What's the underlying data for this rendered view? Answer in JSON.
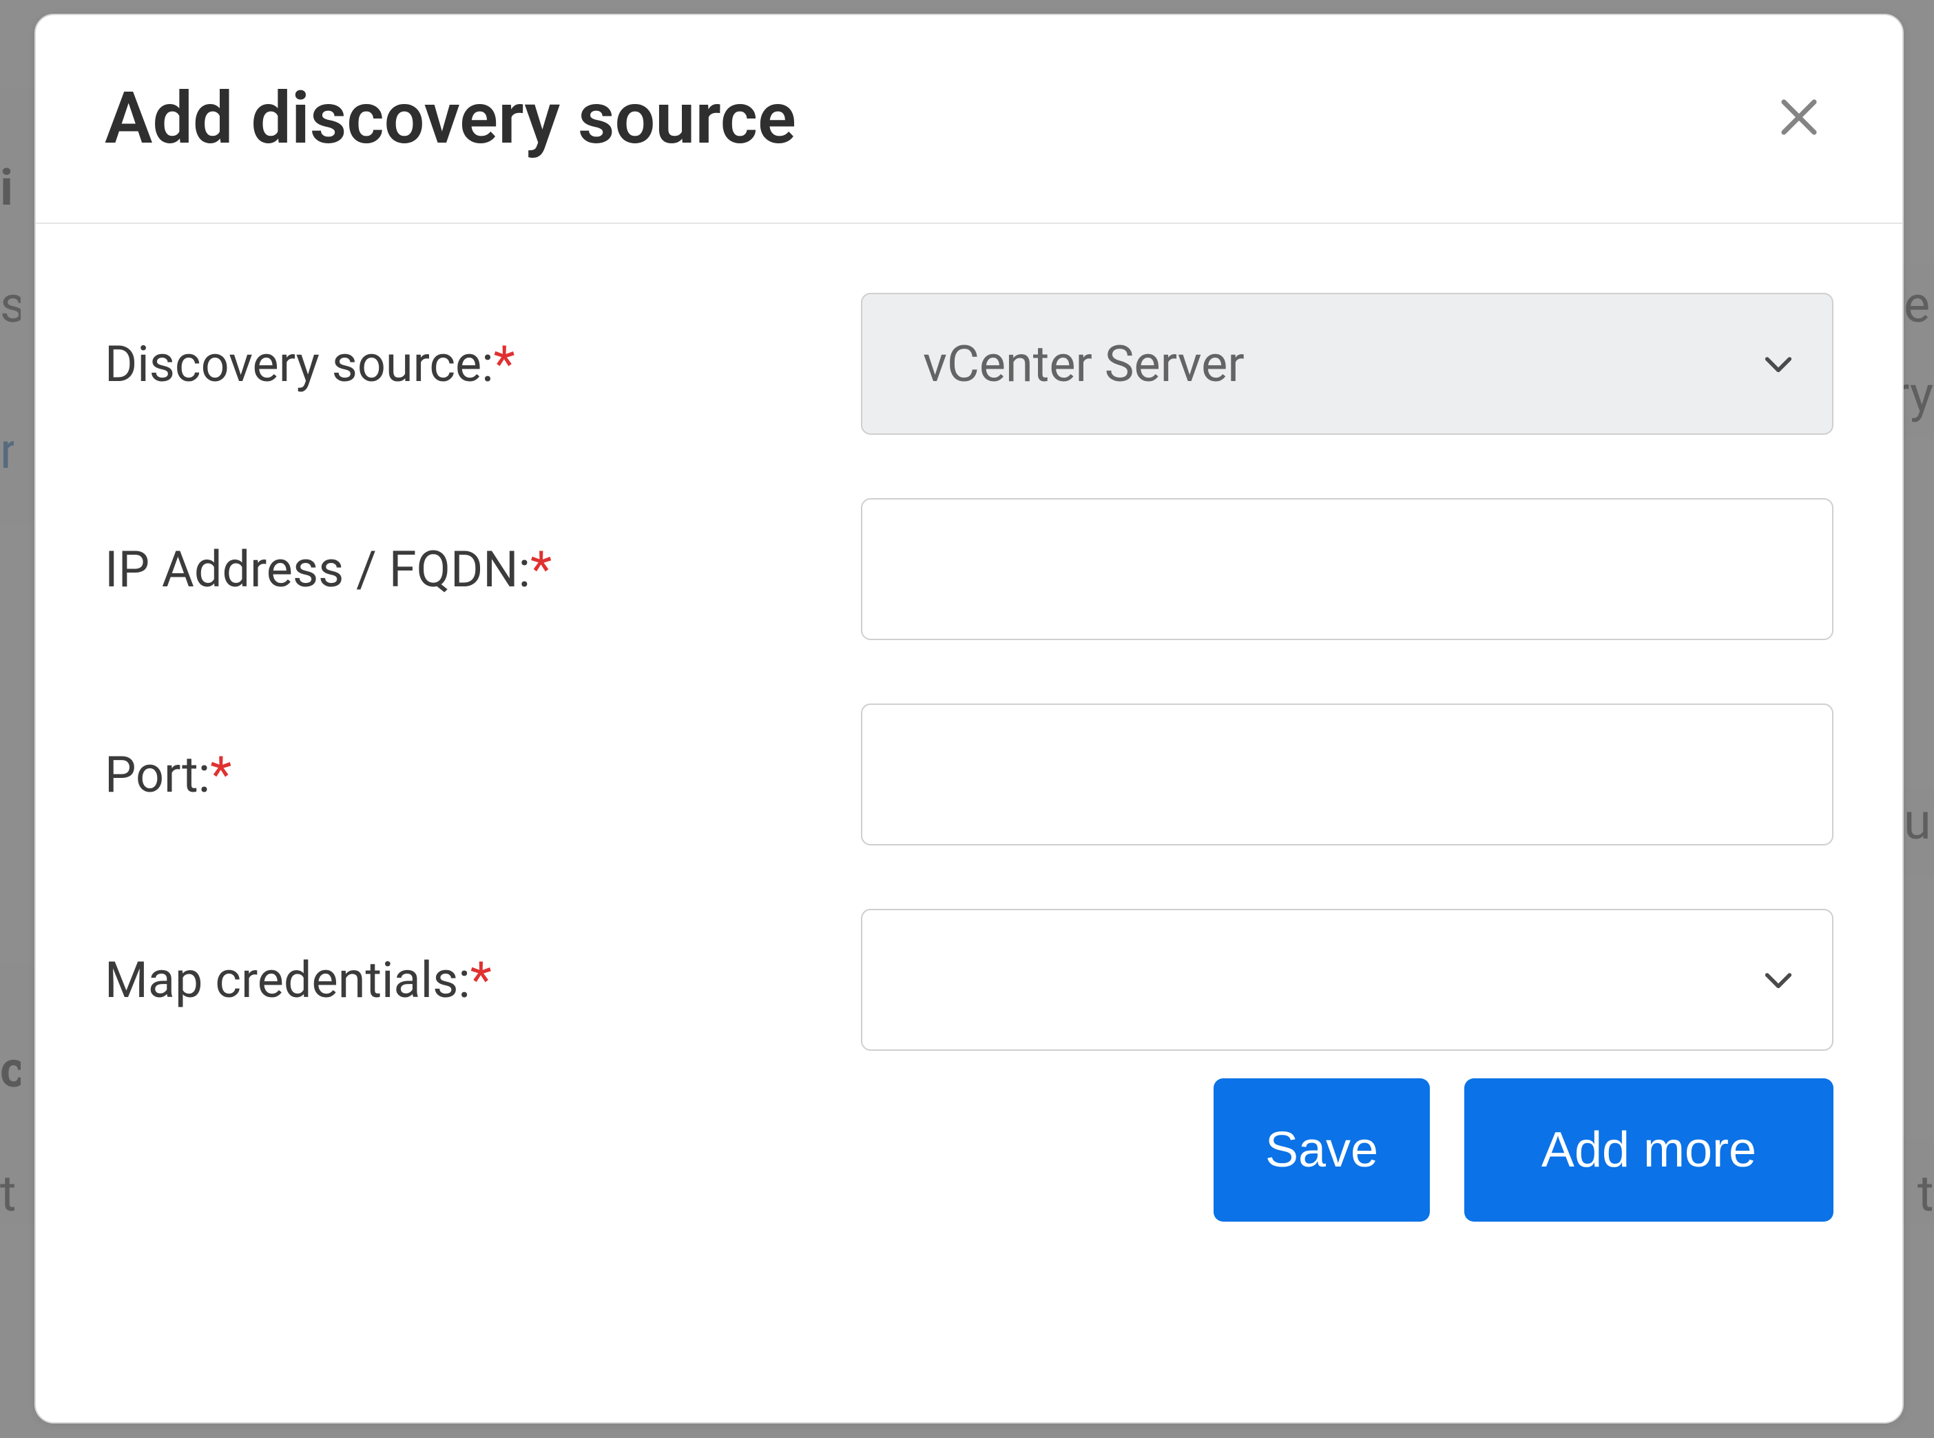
{
  "modal": {
    "title": "Add discovery source",
    "fields": {
      "discovery_source": {
        "label": "Discovery source:",
        "required_mark": "*",
        "value": "vCenter Server"
      },
      "ip_fqdn": {
        "label": "IP Address / FQDN:",
        "required_mark": "*",
        "value": ""
      },
      "port": {
        "label": "Port:",
        "required_mark": "*",
        "value": ""
      },
      "map_credentials": {
        "label": "Map credentials:",
        "required_mark": "*",
        "value": ""
      }
    },
    "buttons": {
      "save": "Save",
      "add_more": "Add more"
    }
  },
  "background": {
    "frag_i": "i",
    "frag_s": "s",
    "frag_r": "r",
    "frag_e": "e",
    "frag_ry": "ry",
    "frag_u": "u",
    "frag_c": "c",
    "frag_t": "t",
    "frag_t2": "t",
    "frag_bracket_right": ""
  }
}
